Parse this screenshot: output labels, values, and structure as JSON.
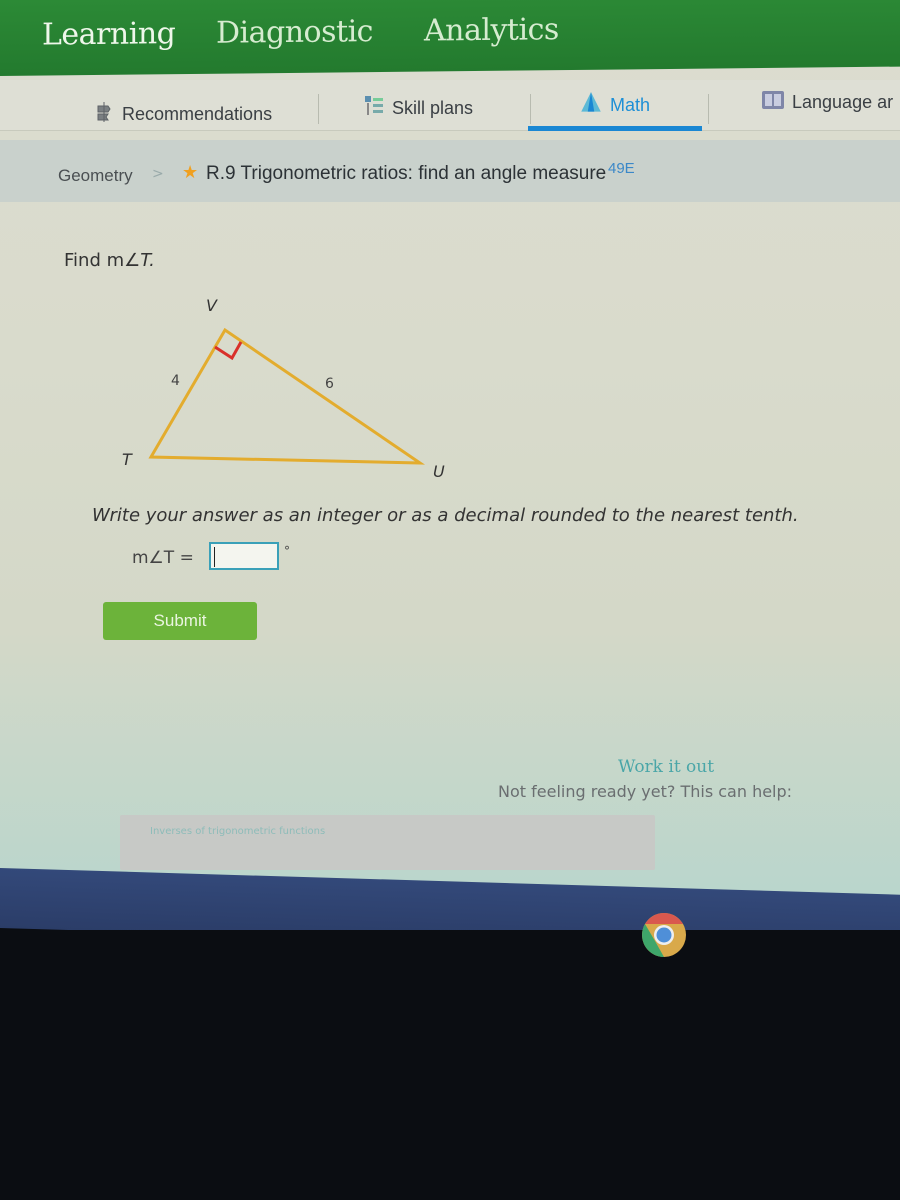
{
  "topnav": {
    "items": [
      {
        "label": "Learning",
        "active": true
      },
      {
        "label": "Diagnostic",
        "active": false
      },
      {
        "label": "Analytics",
        "active": false
      }
    ]
  },
  "subnav": {
    "items": [
      {
        "label": "Recommendations",
        "icon": "recommendations-icon",
        "active": false
      },
      {
        "label": "Skill plans",
        "icon": "skill-plans-icon",
        "active": false
      },
      {
        "label": "Math",
        "icon": "math-pyramid-icon",
        "active": true
      },
      {
        "label": "Language ar",
        "icon": "book-icon",
        "active": false
      }
    ],
    "active_color": "#1a87d3"
  },
  "breadcrumb": {
    "subject": "Geometry",
    "separator": ">",
    "skill": "R.9 Trigonometric ratios: find an angle measure",
    "code": "49E"
  },
  "question": {
    "prompt_prefix": "Find m",
    "prompt_angle": "∠T.",
    "diagram": {
      "vertices": {
        "top": "V",
        "left": "T",
        "right": "U"
      },
      "side_TV": "4",
      "side_VU": "6",
      "right_angle_at": "V",
      "line_color": "#e3ac2e",
      "right_angle_color": "#d9302a"
    },
    "instruction": "Write your answer as an integer or as a decimal rounded to the nearest tenth.",
    "answer_label": "m∠T =",
    "answer_value": "",
    "unit": "°",
    "submit_label": "Submit"
  },
  "help": {
    "title": "Work it out",
    "text": "Not feeling ready yet? This can help:",
    "link": "Inverses of trigonometric functions"
  },
  "taskbar": {
    "apps": [
      {
        "name": "Chrome",
        "icon": "chrome-icon"
      }
    ]
  }
}
